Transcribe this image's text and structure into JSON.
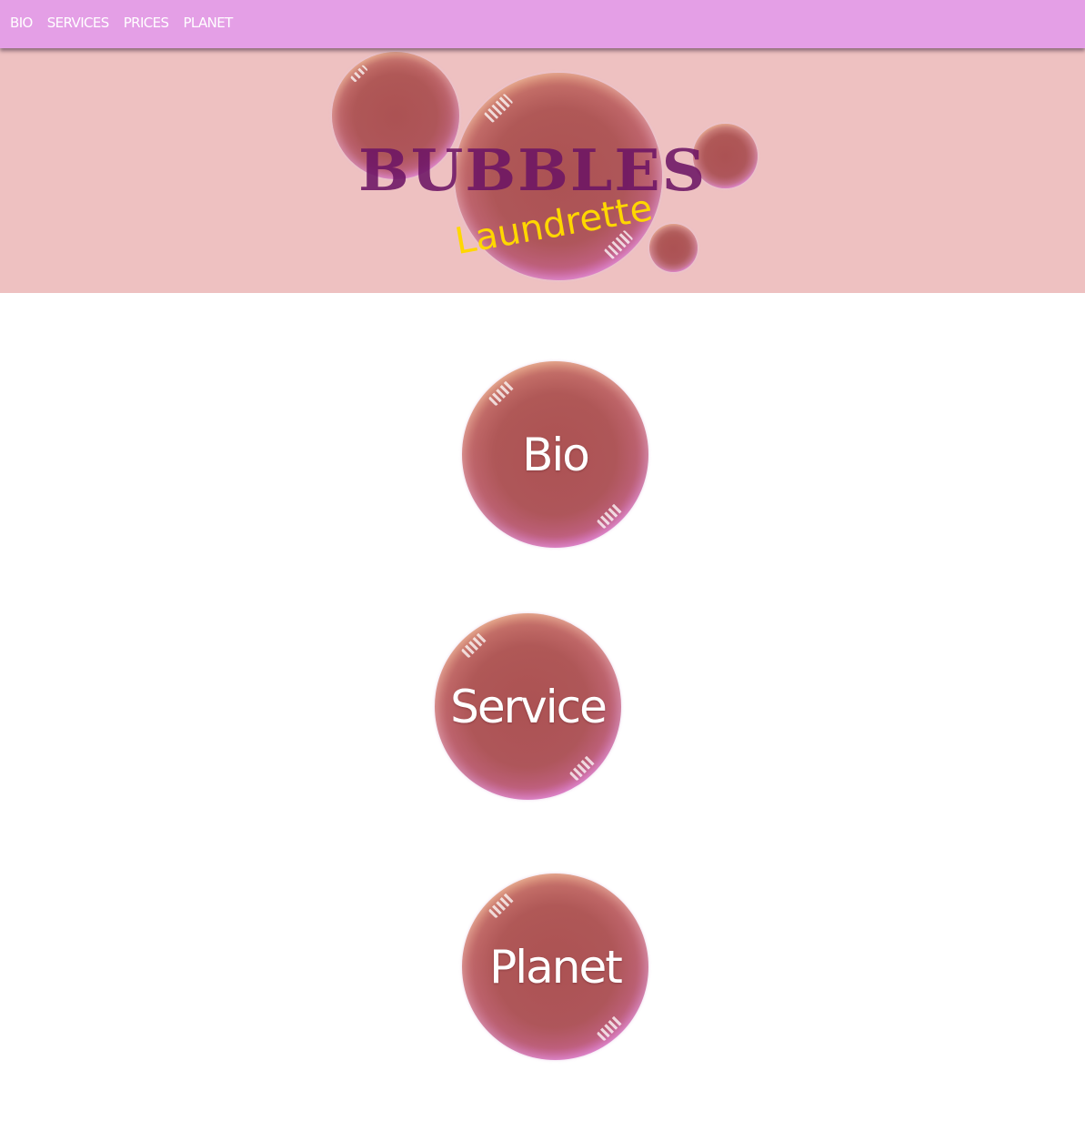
{
  "nav": {
    "items": [
      {
        "label": "BIO"
      },
      {
        "label": "SERVICES"
      },
      {
        "label": "PRICES"
      },
      {
        "label": "PLANET"
      }
    ]
  },
  "logo": {
    "title": "BUBBLES",
    "subtitle": "Laundrette"
  },
  "bubbles": {
    "bio": "Bio",
    "service": "Service",
    "planet": "Planet"
  },
  "colors": {
    "nav_bg": "#e49fe6",
    "banner_bg": "#eec1c1",
    "logo_text": "#6c1464",
    "subtitle_text": "#ffd700",
    "page_bg": "#ffffff"
  }
}
